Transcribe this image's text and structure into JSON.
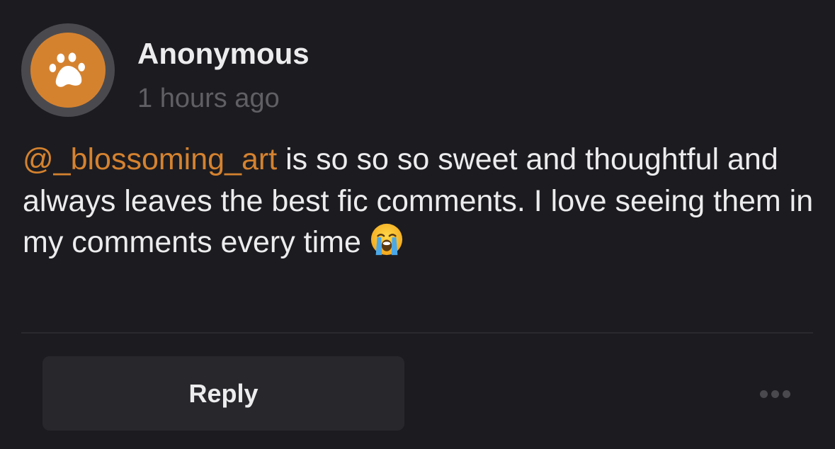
{
  "comment": {
    "author": "Anonymous",
    "timestamp": "1 hours ago",
    "mention": "@_blossoming_art",
    "body_text": " is so so so sweet and thoughtful and always leaves the best fic comments. I love seeing them in my comments every time ",
    "emoji": "loudly-crying-face",
    "avatar_icon": "paw-icon"
  },
  "actions": {
    "reply_label": "Reply",
    "more_icon": "more-options-icon"
  },
  "colors": {
    "accent": "#d5822f",
    "background": "#1c1c20",
    "button": "#28282c",
    "muted_text": "#5f5f64",
    "text": "#ececee"
  }
}
